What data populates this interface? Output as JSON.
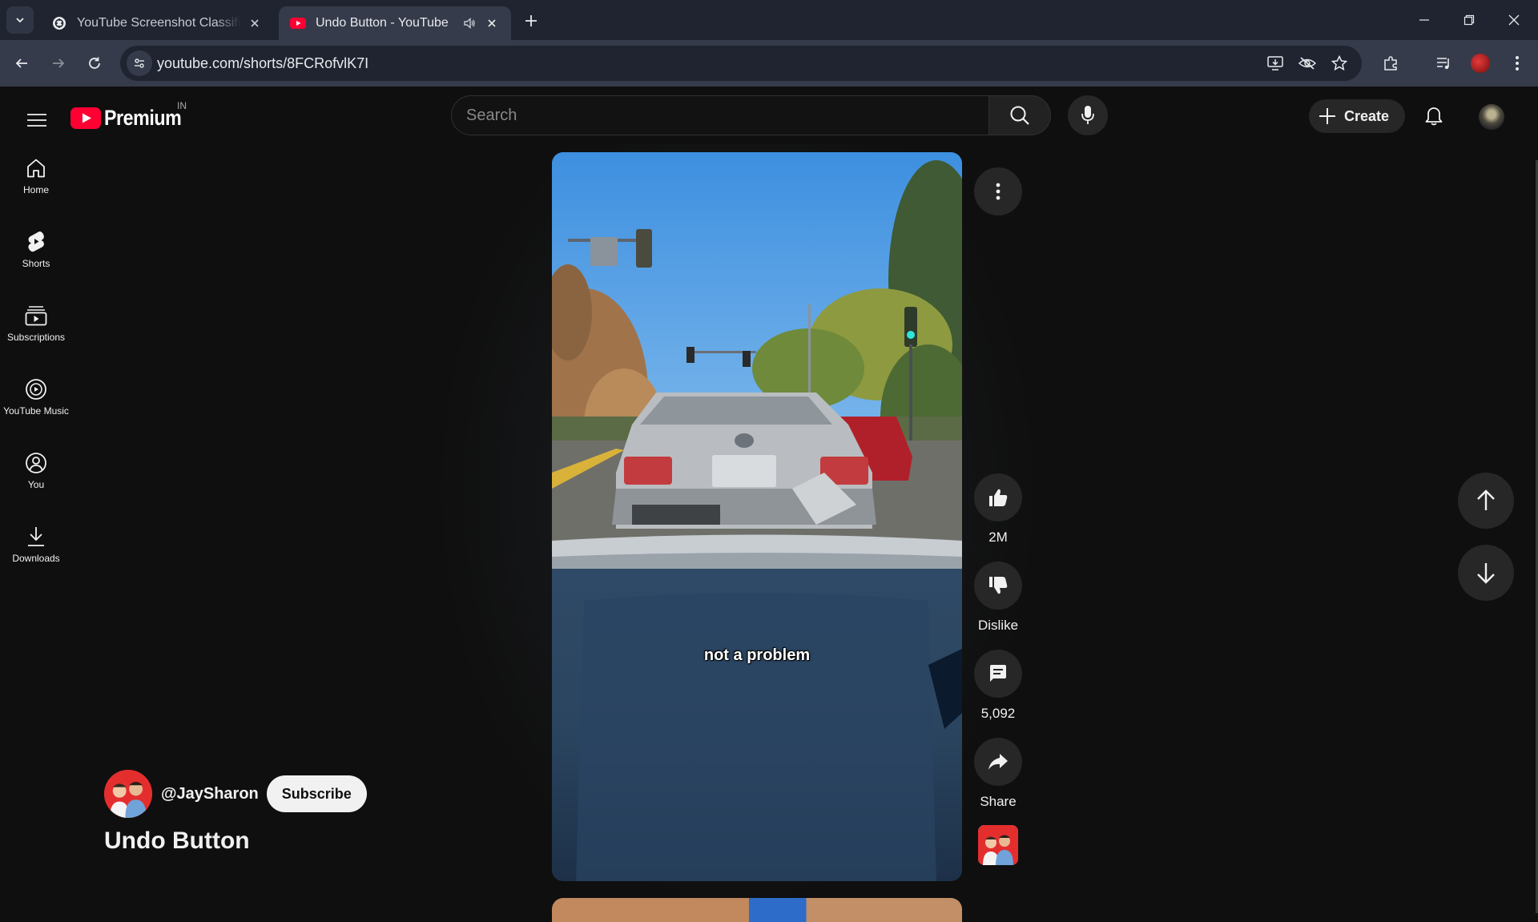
{
  "browser": {
    "tabs": [
      {
        "title": "YouTube Screenshot Classification",
        "active": false
      },
      {
        "title": "Undo Button - YouTube",
        "active": true,
        "playing_audio": true
      }
    ],
    "url": "youtube.com/shorts/8FCRofvlK7I"
  },
  "header": {
    "logo_text": "Premium",
    "country_code": "IN",
    "search_placeholder": "Search",
    "create_label": "Create"
  },
  "sidebar": {
    "items": [
      {
        "label": "Home",
        "icon": "home-icon"
      },
      {
        "label": "Shorts",
        "icon": "shorts-icon"
      },
      {
        "label": "Subscriptions",
        "icon": "subscriptions-icon"
      },
      {
        "label": "YouTube Music",
        "icon": "youtube-music-icon"
      },
      {
        "label": "You",
        "icon": "you-icon"
      },
      {
        "label": "Downloads",
        "icon": "downloads-icon"
      }
    ]
  },
  "short": {
    "caption": "not a problem",
    "channel_handle": "@JaySharon",
    "subscribe_label": "Subscribe",
    "title": "Undo Button",
    "actions": {
      "like_count": "2M",
      "dislike_label": "Dislike",
      "comment_count": "5,092",
      "share_label": "Share"
    }
  },
  "colors": {
    "background": "#0f0f0f",
    "youtube_red": "#ff0033",
    "button_bg": "#272727",
    "browser_frame": "#1f2430",
    "browser_toolbar": "#353b4a"
  }
}
